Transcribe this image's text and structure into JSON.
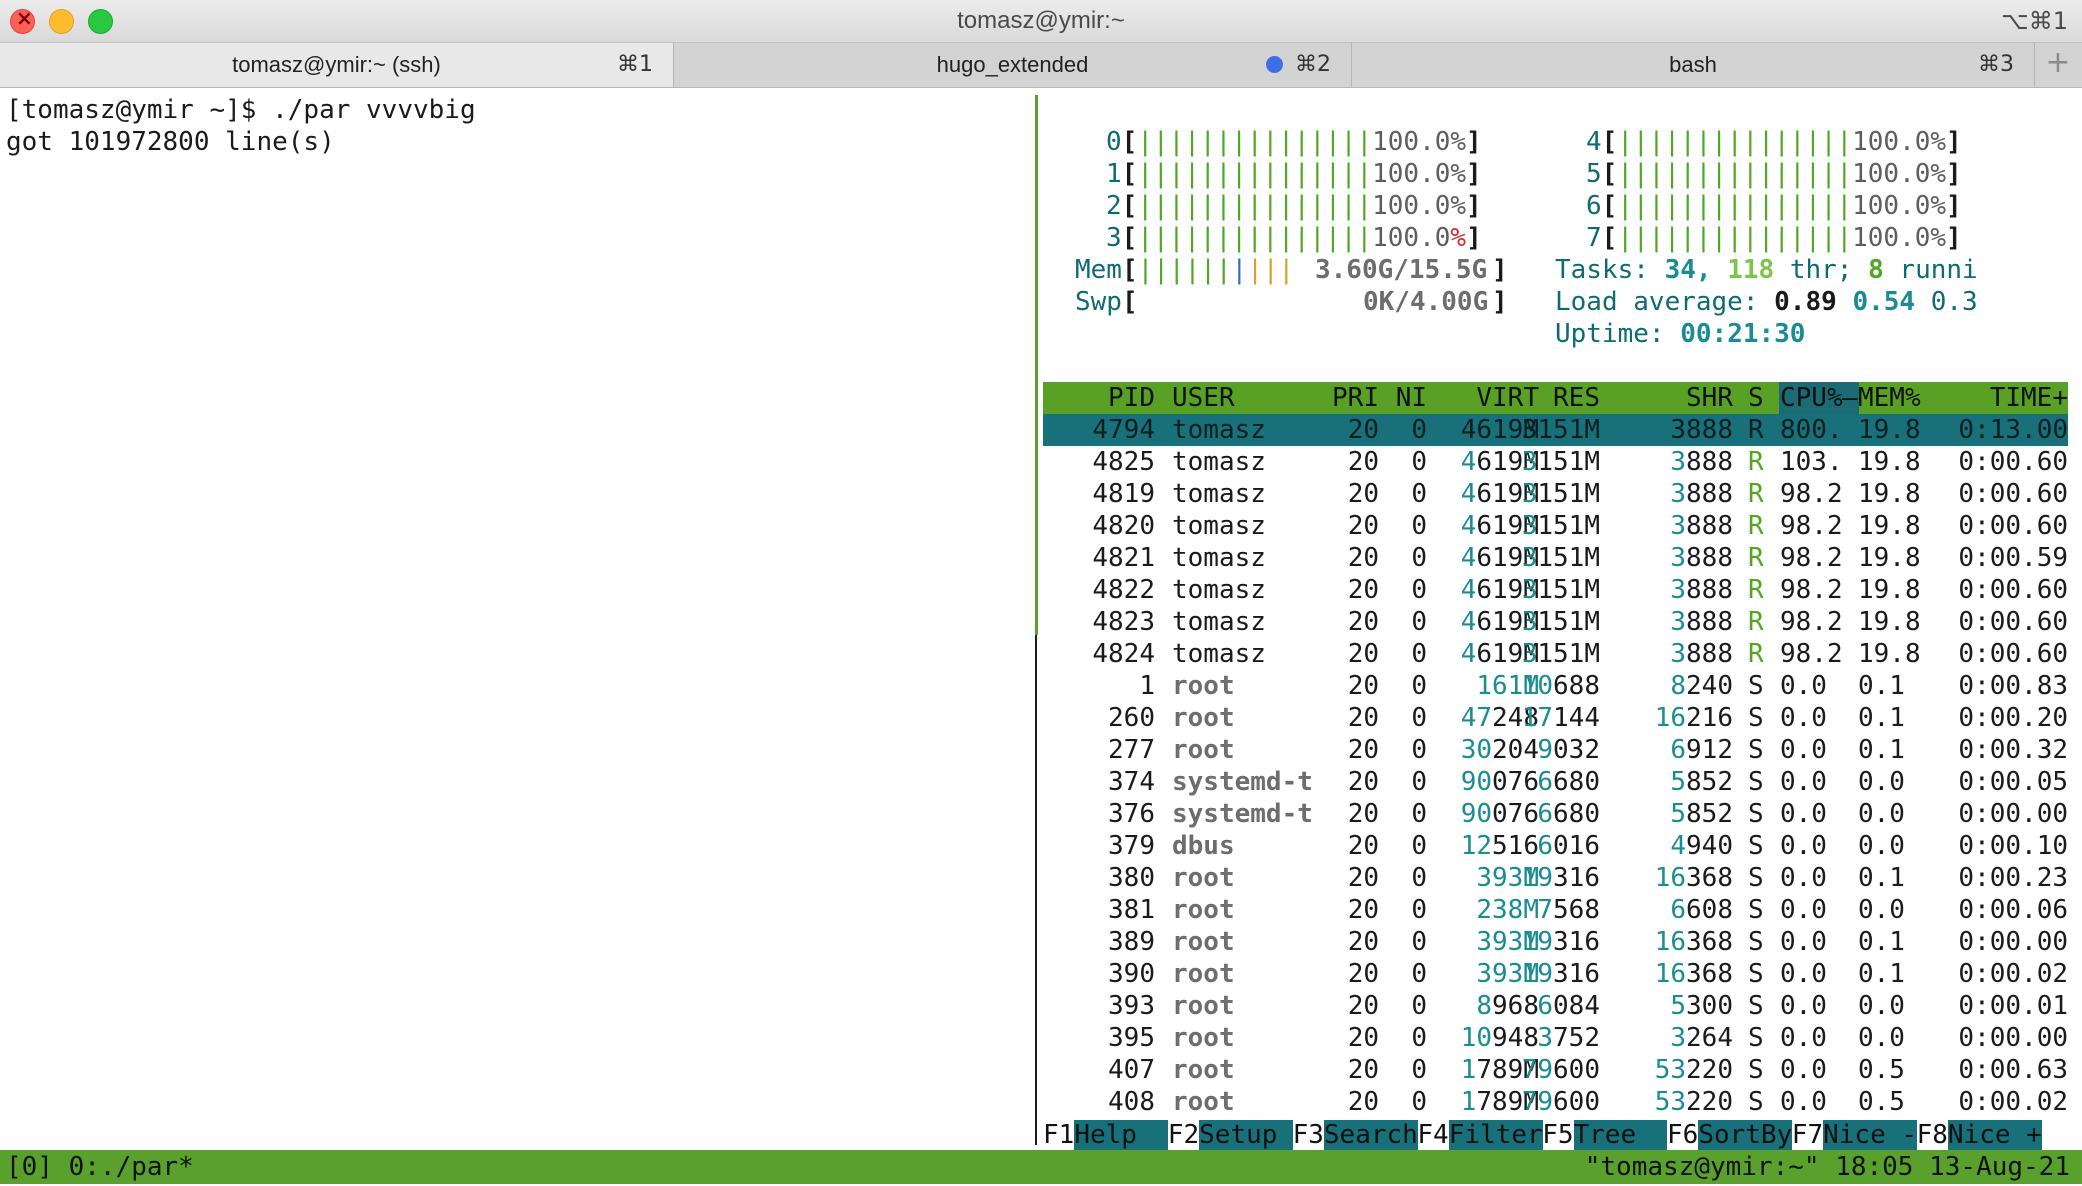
{
  "window": {
    "title": "tomasz@ymir:~",
    "shortcut": "⌥⌘1"
  },
  "tabs": [
    {
      "label": "tomasz@ymir:~ (ssh)",
      "shortcut": "⌘1",
      "active": true
    },
    {
      "label": "hugo_extended",
      "shortcut": "⌘2",
      "active": false,
      "activity_dot_color": "#3f6fe8"
    },
    {
      "label": "bash",
      "shortcut": "⌘3",
      "active": false
    }
  ],
  "new_tab_label": "+",
  "left_pane": {
    "lines": [
      "[tomasz@ymir ~]$ ./par vvvvbig",
      "got 101972800 line(s)"
    ]
  },
  "htop": {
    "cpus": [
      {
        "id": "0",
        "bar": "|||||||||||||||",
        "pct": "100.0%"
      },
      {
        "id": "1",
        "bar": "|||||||||||||||",
        "pct": "100.0%"
      },
      {
        "id": "2",
        "bar": "|||||||||||||||",
        "pct": "100.0%"
      },
      {
        "id": "3",
        "bar": "|||||||||||||||",
        "pct": "100.0%"
      },
      {
        "id": "4",
        "bar": "|||||||||||||||",
        "pct": "100.0%"
      },
      {
        "id": "5",
        "bar": "|||||||||||||||",
        "pct": "100.0%"
      },
      {
        "id": "6",
        "bar": "|||||||||||||||",
        "pct": "100.0%"
      },
      {
        "id": "7",
        "bar": "|||||||||||||||",
        "pct": "100.0%"
      }
    ],
    "mem": {
      "label": "Mem",
      "bar_green": "||||||",
      "bar_blue": "|",
      "bar_yellow": "|||",
      "value": "3.60G/15.5G"
    },
    "swp": {
      "label": "Swp",
      "value": "0K/4.00G"
    },
    "tasks": {
      "label": "Tasks:",
      "count": "34,",
      "thr": "118",
      "thr_label": "thr;",
      "running": "8",
      "running_label": "runni"
    },
    "load": {
      "label": "Load average:",
      "one": "0.89",
      "five": "0.54",
      "fifteen": "0.3"
    },
    "uptime": {
      "label": "Uptime:",
      "value": "00:21:30"
    },
    "columns": [
      "PID",
      "USER",
      "PRI",
      "NI",
      "VIRT",
      "RES",
      "SHR",
      "S",
      "CPU%",
      "MEM%",
      "TIME+"
    ],
    "processes": [
      [
        "4794",
        "tomasz",
        "20",
        "0",
        "4619M",
        "3151M",
        "3888",
        "R",
        "800.",
        "19.8",
        "0:13.00"
      ],
      [
        "4825",
        "tomasz",
        "20",
        "0",
        "4619M",
        "3151M",
        "3888",
        "R",
        "103.",
        "19.8",
        "0:00.60"
      ],
      [
        "4819",
        "tomasz",
        "20",
        "0",
        "4619M",
        "3151M",
        "3888",
        "R",
        "98.2",
        "19.8",
        "0:00.60"
      ],
      [
        "4820",
        "tomasz",
        "20",
        "0",
        "4619M",
        "3151M",
        "3888",
        "R",
        "98.2",
        "19.8",
        "0:00.60"
      ],
      [
        "4821",
        "tomasz",
        "20",
        "0",
        "4619M",
        "3151M",
        "3888",
        "R",
        "98.2",
        "19.8",
        "0:00.59"
      ],
      [
        "4822",
        "tomasz",
        "20",
        "0",
        "4619M",
        "3151M",
        "3888",
        "R",
        "98.2",
        "19.8",
        "0:00.60"
      ],
      [
        "4823",
        "tomasz",
        "20",
        "0",
        "4619M",
        "3151M",
        "3888",
        "R",
        "98.2",
        "19.8",
        "0:00.60"
      ],
      [
        "4824",
        "tomasz",
        "20",
        "0",
        "4619M",
        "3151M",
        "3888",
        "R",
        "98.2",
        "19.8",
        "0:00.60"
      ],
      [
        "1",
        "root",
        "20",
        "0",
        "161M",
        "10688",
        "8240",
        "S",
        "0.0",
        "0.1",
        "0:00.83"
      ],
      [
        "260",
        "root",
        "20",
        "0",
        "47248",
        "17144",
        "16216",
        "S",
        "0.0",
        "0.1",
        "0:00.20"
      ],
      [
        "277",
        "root",
        "20",
        "0",
        "30204",
        "9032",
        "6912",
        "S",
        "0.0",
        "0.1",
        "0:00.32"
      ],
      [
        "374",
        "systemd-t",
        "20",
        "0",
        "90076",
        "6680",
        "5852",
        "S",
        "0.0",
        "0.0",
        "0:00.05"
      ],
      [
        "376",
        "systemd-t",
        "20",
        "0",
        "90076",
        "6680",
        "5852",
        "S",
        "0.0",
        "0.0",
        "0:00.00"
      ],
      [
        "379",
        "dbus",
        "20",
        "0",
        "12516",
        "6016",
        "4940",
        "S",
        "0.0",
        "0.0",
        "0:00.10"
      ],
      [
        "380",
        "root",
        "20",
        "0",
        "393M",
        "19316",
        "16368",
        "S",
        "0.0",
        "0.1",
        "0:00.23"
      ],
      [
        "381",
        "root",
        "20",
        "0",
        "238M",
        "7568",
        "6608",
        "S",
        "0.0",
        "0.0",
        "0:00.06"
      ],
      [
        "389",
        "root",
        "20",
        "0",
        "393M",
        "19316",
        "16368",
        "S",
        "0.0",
        "0.1",
        "0:00.00"
      ],
      [
        "390",
        "root",
        "20",
        "0",
        "393M",
        "19316",
        "16368",
        "S",
        "0.0",
        "0.1",
        "0:00.02"
      ],
      [
        "393",
        "root",
        "20",
        "0",
        "8968",
        "6084",
        "5300",
        "S",
        "0.0",
        "0.0",
        "0:00.01"
      ],
      [
        "395",
        "root",
        "20",
        "0",
        "10948",
        "3752",
        "3264",
        "S",
        "0.0",
        "0.0",
        "0:00.00"
      ],
      [
        "407",
        "root",
        "20",
        "0",
        "1789M",
        "79600",
        "53220",
        "S",
        "0.0",
        "0.5",
        "0:00.63"
      ],
      [
        "408",
        "root",
        "20",
        "0",
        "1789M",
        "79600",
        "53220",
        "S",
        "0.0",
        "0.5",
        "0:00.02"
      ]
    ],
    "fkeys": [
      {
        "key": "F1",
        "label": "Help  "
      },
      {
        "key": "F2",
        "label": "Setup "
      },
      {
        "key": "F3",
        "label": "Search"
      },
      {
        "key": "F4",
        "label": "Filter"
      },
      {
        "key": "F5",
        "label": "Tree  "
      },
      {
        "key": "F6",
        "label": "SortBy"
      },
      {
        "key": "F7",
        "label": "Nice -"
      },
      {
        "key": "F8",
        "label": "Nice +"
      }
    ]
  },
  "tmux": {
    "left": "[0] 0:./par*",
    "right": "\"tomasz@ymir:~\" 18:05 13-Aug-21"
  }
}
